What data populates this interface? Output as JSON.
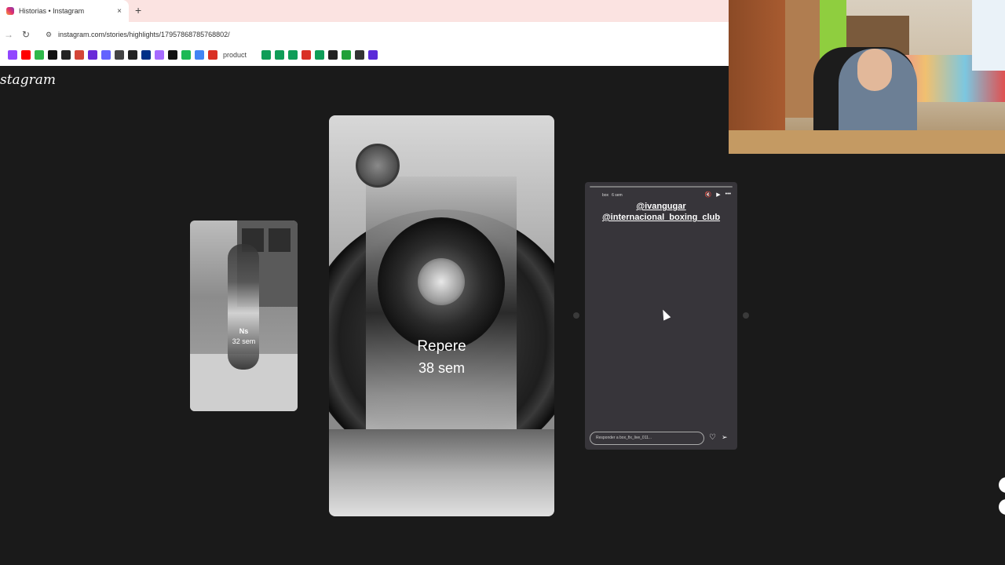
{
  "browser": {
    "tab_title": "Historias • Instagram",
    "tab_close": "×",
    "new_tab": "+",
    "back": "←",
    "forward": "→",
    "reload": "↻",
    "url": "instagram.com/stories/highlights/17957868785768802/",
    "bookmarks": [
      {
        "icon": "twitch-icon",
        "color": "#9146ff"
      },
      {
        "icon": "youtube-icon",
        "color": "#ff0000"
      },
      {
        "icon": "app-38-icon",
        "color": "#2fb84a"
      },
      {
        "icon": "tiktok-icon",
        "color": "#111111"
      },
      {
        "icon": "threads-icon",
        "color": "#222222"
      },
      {
        "icon": "gmail-icon",
        "color": "#d44638"
      },
      {
        "icon": "bookmark-icon",
        "color": "#6a2bd8"
      },
      {
        "icon": "mastodon-icon",
        "color": "#6364ff"
      },
      {
        "icon": "infinity-icon",
        "color": "#444444"
      },
      {
        "icon": "whatsapp-icon",
        "color": "#222222"
      },
      {
        "icon": "paypal-icon",
        "color": "#003087"
      },
      {
        "icon": "triangle-icon",
        "color": "#a66bff"
      },
      {
        "icon": "dot-icon",
        "color": "#111111"
      },
      {
        "icon": "spotify-icon",
        "color": "#1db954"
      },
      {
        "icon": "play-icon",
        "color": "#4285f4"
      },
      {
        "icon": "c-logo-icon",
        "color": "#d93025"
      }
    ],
    "bookmark_text": "product",
    "bookmarks_after": [
      {
        "icon": "sheet-icon",
        "color": "#0f9d58"
      },
      {
        "icon": "sheet-icon",
        "color": "#0f9d58"
      },
      {
        "icon": "sheet-icon",
        "color": "#0f9d58"
      },
      {
        "icon": "c-logo-icon",
        "color": "#d93025"
      },
      {
        "icon": "sheet-icon",
        "color": "#0f9d58"
      },
      {
        "icon": "github-icon",
        "color": "#222222"
      },
      {
        "icon": "k-icon",
        "color": "#21a038"
      },
      {
        "icon": "dollar-icon",
        "color": "#333333"
      },
      {
        "icon": "square-icon",
        "color": "#5b2bd8"
      }
    ]
  },
  "instagram": {
    "logo": "stagram",
    "stories": {
      "left": {
        "name": "Ns",
        "time": "32 sem"
      },
      "main": {
        "name": "Repere",
        "time": "38 sem"
      },
      "right": {
        "username": "box",
        "time": "6 sem",
        "mentions": [
          "@ivangugar",
          "@internacional_boxing_club"
        ],
        "reply_placeholder": "Responder a box_fix_live_011...",
        "controls": {
          "mute": "🔇",
          "play": "▶",
          "more": "•••"
        },
        "heart": "♡",
        "send": "➢"
      }
    }
  },
  "colors": {
    "background": "#1a1a1a",
    "text": "#ffffff"
  }
}
